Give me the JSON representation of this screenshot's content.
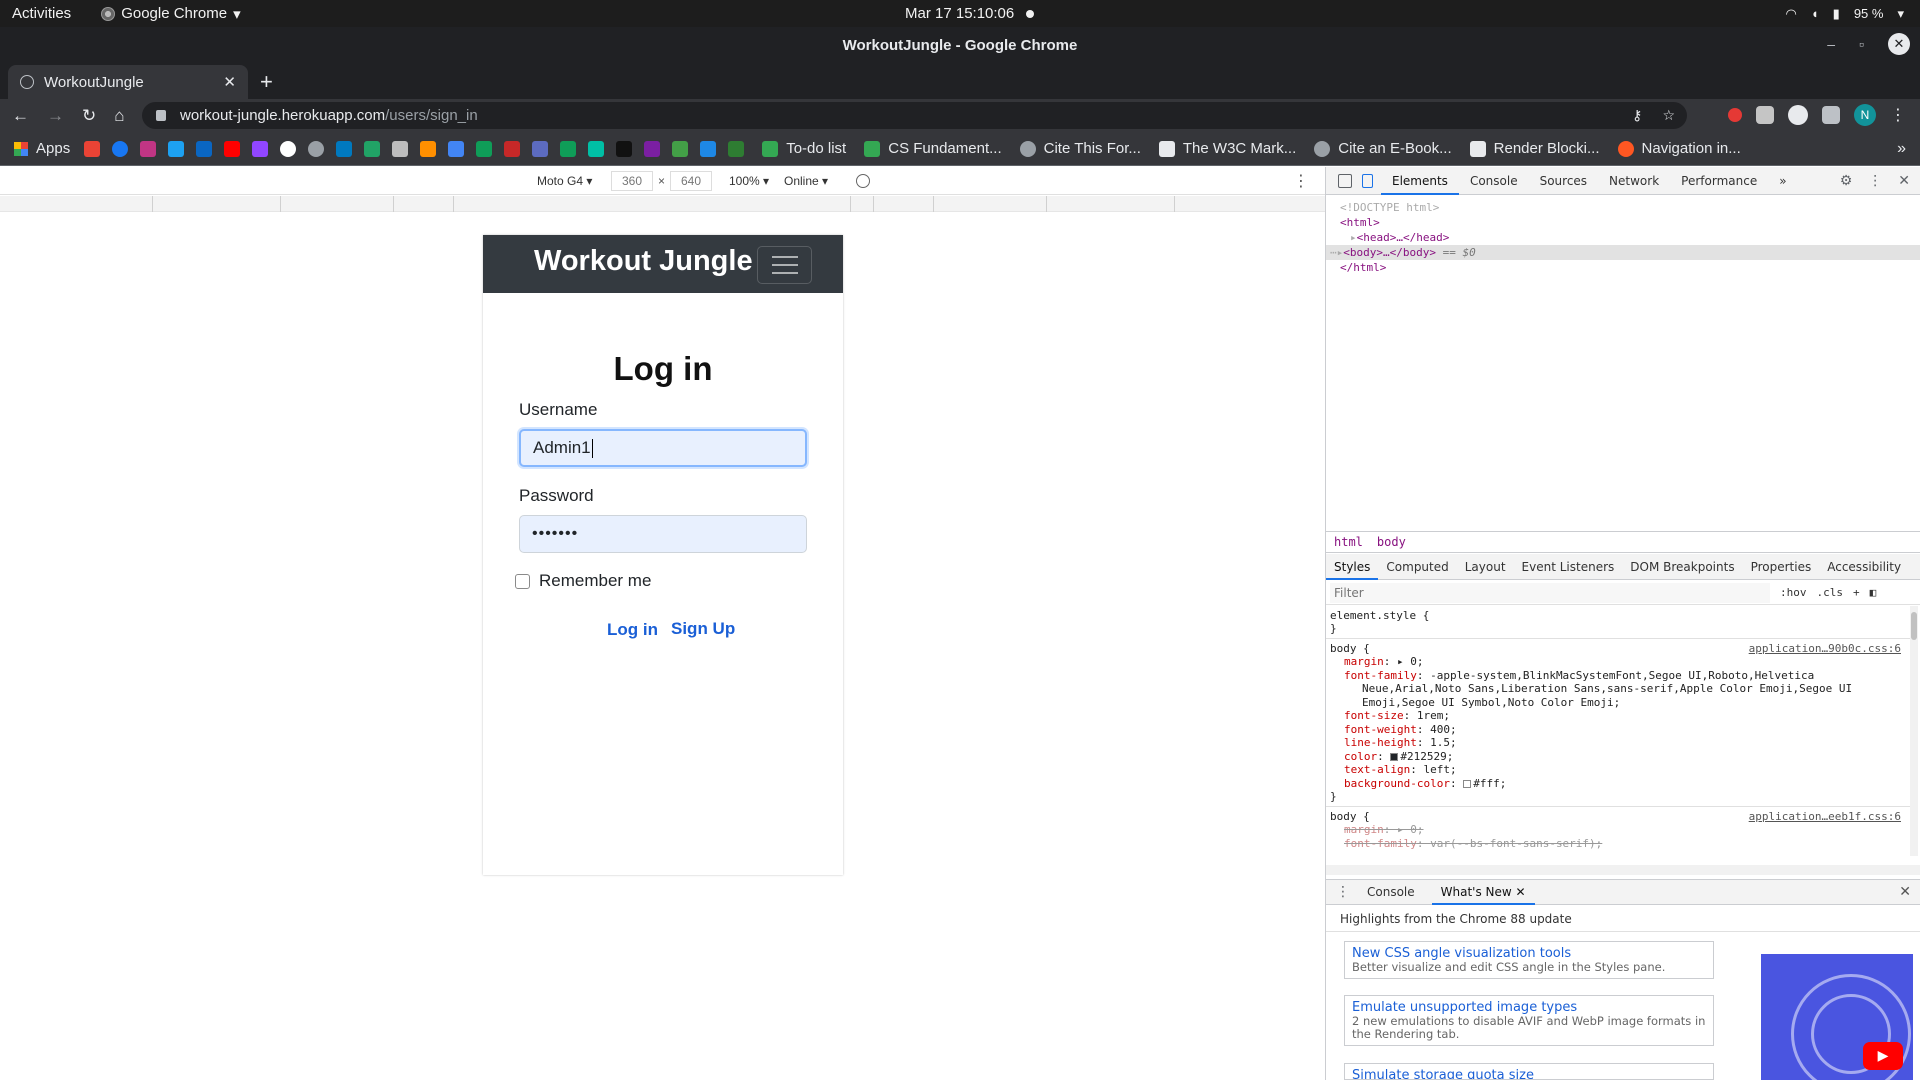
{
  "system_bar": {
    "activities": "Activities",
    "app_name": "Google Chrome",
    "app_menu_arrow": "▾",
    "clock": "Mar 17  15:10:06",
    "battery": "95 %"
  },
  "window": {
    "title": "WorkoutJungle - Google Chrome",
    "min": "–",
    "max": "▫",
    "close": "✕"
  },
  "tabs": [
    {
      "label": "WorkoutJungle",
      "close": "✕"
    }
  ],
  "new_tab": "+",
  "toolbar": {
    "back": "←",
    "forward": "→",
    "reload": "↻",
    "home": "⌂",
    "url_host": "workout-jungle.herokuapp.com",
    "url_path": "/users/sign_in",
    "key_icon": "⚷",
    "star_icon": "☆",
    "avatar_letter": "N",
    "menu": "⋮"
  },
  "bookmarks": {
    "apps_label": "Apps",
    "items": [
      {
        "label": "To-do list",
        "color": "#34a853"
      },
      {
        "label": "CS Fundament...",
        "color": "#34a853"
      },
      {
        "label": "Cite This For...",
        "color": "#9aa0a6"
      },
      {
        "label": "The W3C Mark...",
        "color": "#1a73e8"
      },
      {
        "label": "Cite an E-Book...",
        "color": "#9aa0a6"
      },
      {
        "label": "Render Blocki...",
        "color": "#e8eaed"
      },
      {
        "label": "Navigation in...",
        "color": "#ff5722"
      }
    ],
    "more": "»"
  },
  "device_toolbar": {
    "device": "Moto G4 ▾",
    "width": "360",
    "times": "×",
    "height": "640",
    "zoom": "100% ▾",
    "network": "Online ▾",
    "menu": "⋮"
  },
  "page": {
    "brand": "Workout Jungle",
    "heading": "Log in",
    "username_label": "Username",
    "username_value": "Admin1",
    "password_label": "Password",
    "password_value": "•••••••",
    "remember_label": "Remember me",
    "login_link": "Log in",
    "signup_link": "Sign Up"
  },
  "devtools": {
    "tabs": [
      "Elements",
      "Console",
      "Sources",
      "Network",
      "Performance"
    ],
    "more_tabs": "»",
    "dom_lines": {
      "doctype": "<!DOCTYPE html>",
      "html_open": "<html>",
      "head": "<head>…</head>",
      "body": "<body>…</body>",
      "body_eq": "== $0",
      "html_close": "</html>"
    },
    "breadcrumbs": [
      "html",
      "body"
    ],
    "subtabs": [
      "Styles",
      "Computed",
      "Layout",
      "Event Listeners",
      "DOM Breakpoints",
      "Properties",
      "Accessibility"
    ],
    "filter_placeholder": "Filter",
    "hov": ":hov",
    "cls": ".cls",
    "add": "+",
    "element_style": "element.style {",
    "close_brace": "}",
    "rule1": {
      "selector": "body {",
      "source": "application…90b0c.css:6",
      "decls": [
        {
          "name": "margin",
          "value": "▸ 0;"
        },
        {
          "name": "font-family",
          "value": "-apple-system,BlinkMacSystemFont,Segoe UI,Roboto,Helvetica"
        },
        {
          "name": "",
          "value": "Neue,Arial,Noto Sans,Liberation Sans,sans-serif,Apple Color Emoji,Segoe UI"
        },
        {
          "name": "",
          "value": "Emoji,Segoe UI Symbol,Noto Color Emoji;"
        },
        {
          "name": "font-size",
          "value": "1rem;"
        },
        {
          "name": "font-weight",
          "value": "400;"
        },
        {
          "name": "line-height",
          "value": "1.5;"
        },
        {
          "name": "color",
          "value": "#212529;"
        },
        {
          "name": "text-align",
          "value": "left;"
        },
        {
          "name": "background-color",
          "value": "#fff;"
        }
      ]
    },
    "rule2": {
      "selector": "body {",
      "source": "application…eeb1f.css:6",
      "decls": [
        {
          "name": "margin",
          "value": "▸ 0;"
        },
        {
          "name": "font-family",
          "value": "var(--bs-font-sans-serif);"
        }
      ]
    },
    "drawer_tabs": [
      "Console",
      "What's New"
    ],
    "drawer_close_tab": "✕",
    "whats_new_header": "Highlights from the Chrome 88 update",
    "whats_new": [
      {
        "title": "New CSS angle visualization tools",
        "desc": "Better visualize and edit CSS angle in the Styles pane."
      },
      {
        "title": "Emulate unsupported image types",
        "desc": "2 new emulations to disable AVIF and WebP image formats in the Rendering tab."
      },
      {
        "title": "Simulate storage quota size",
        "desc": ""
      }
    ],
    "yt_icon": "▶"
  }
}
